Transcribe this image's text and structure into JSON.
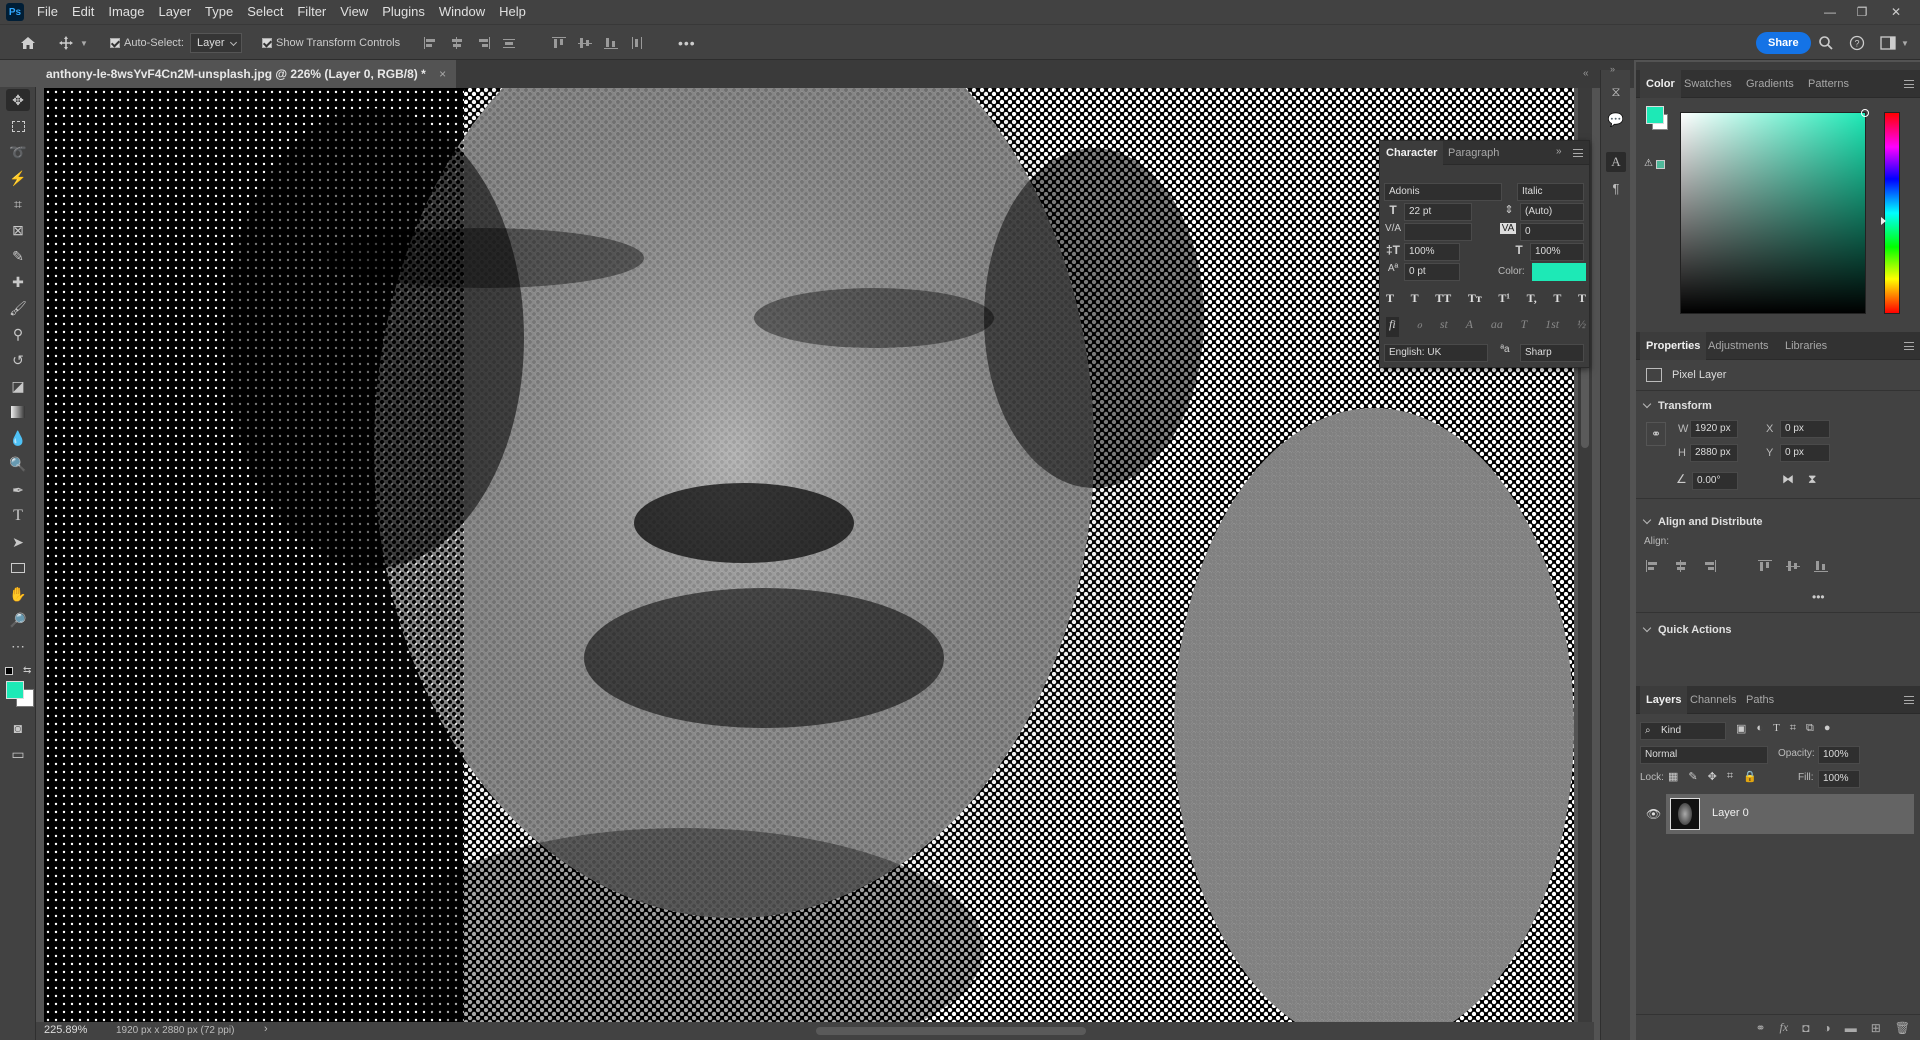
{
  "app": {
    "logo": "Ps"
  },
  "menu": [
    "File",
    "Edit",
    "Image",
    "Layer",
    "Type",
    "Select",
    "Filter",
    "View",
    "Plugins",
    "Window",
    "Help"
  ],
  "options": {
    "auto_select_label": "Auto-Select:",
    "auto_select_value": "Layer",
    "show_transform_label": "Show Transform Controls",
    "share_label": "Share",
    "more": "•••"
  },
  "document": {
    "tab_title": "anthony-le-8wsYvF4Cn2M-unsplash.jpg @ 226% (Layer 0, RGB/8) *",
    "close": "×"
  },
  "status": {
    "zoom": "225.89%",
    "info": "1920 px x 2880 px (72 ppi)",
    "arrow": "›"
  },
  "colors": {
    "foreground": "#1de9b6",
    "background": "#ffffff",
    "accent": "#1473e6"
  },
  "color_panel": {
    "tabs": [
      "Color",
      "Swatches",
      "Gradients",
      "Patterns"
    ],
    "active": "Color"
  },
  "character_panel": {
    "tabs": [
      "Character",
      "Paragraph"
    ],
    "font_family": "Adonis",
    "font_style": "Italic",
    "font_size": "22 pt",
    "leading": "(Auto)",
    "kerning": "",
    "tracking": "0",
    "vertical_scale": "100%",
    "horizontal_scale": "100%",
    "baseline_shift": "0 pt",
    "color_label": "Color:",
    "language": "English: UK",
    "antialias": "Sharp",
    "aa_icon": "ªa",
    "style_buttons": [
      "T",
      "T",
      "TT",
      "Tт",
      "T¹",
      "T,",
      "T",
      "T"
    ],
    "opentype_buttons": [
      "fi",
      "ℴ",
      "st",
      "A",
      "aa",
      "T",
      "1st",
      "½"
    ]
  },
  "properties_panel": {
    "tabs": [
      "Properties",
      "Adjustments",
      "Libraries"
    ],
    "layer_type": "Pixel Layer",
    "transform_title": "Transform",
    "w_label": "W",
    "w": "1920 px",
    "h_label": "H",
    "h": "2880 px",
    "x_label": "X",
    "x": "0 px",
    "y_label": "Y",
    "y": "0 px",
    "angle": "0.00°",
    "align_title": "Align and Distribute",
    "align_label": "Align:",
    "more": "•••",
    "quick_actions_title": "Quick Actions"
  },
  "layers_panel": {
    "tabs": [
      "Layers",
      "Channels",
      "Paths"
    ],
    "filter": "Kind",
    "blend_mode": "Normal",
    "opacity_label": "Opacity:",
    "opacity": "100%",
    "lock_label": "Lock:",
    "fill_label": "Fill:",
    "fill": "100%",
    "layers": [
      {
        "name": "Layer 0",
        "visible": true
      }
    ],
    "footer_icons": [
      "link-icon",
      "fx-icon",
      "mask-icon",
      "adjustment-icon",
      "folder-icon",
      "new-layer-icon",
      "trash-icon"
    ],
    "fx": "fx"
  }
}
